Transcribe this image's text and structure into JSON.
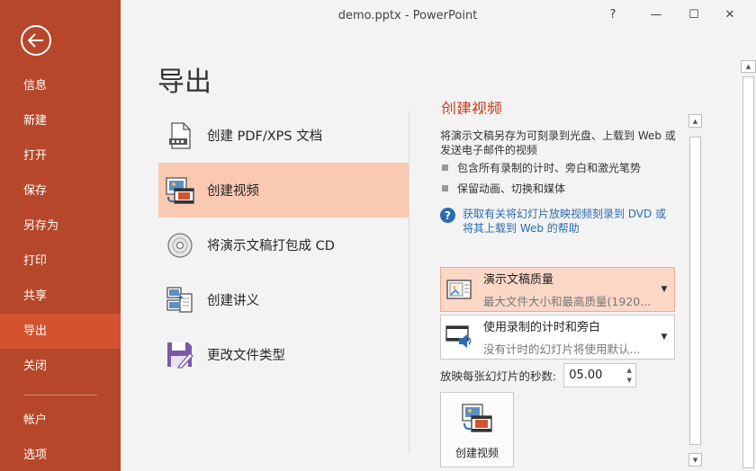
{
  "window": {
    "title": "demo.pptx - PowerPoint",
    "help_glyph": "?",
    "minimize_glyph": "—",
    "maximize_glyph": "☐",
    "close_glyph": "✕"
  },
  "colors": {
    "sidebar_bg": "#b7472a",
    "sidebar_active": "#d35230",
    "option_active_bg": "#fac9b2",
    "heading_accent": "#c43e1c",
    "link": "#2b6cb0"
  },
  "sidebar": {
    "back_icon": "back-arrow-icon",
    "items": [
      {
        "label": "信息"
      },
      {
        "label": "新建"
      },
      {
        "label": "打开"
      },
      {
        "label": "保存"
      },
      {
        "label": "另存为"
      },
      {
        "label": "打印"
      },
      {
        "label": "共享"
      },
      {
        "label": "导出",
        "active": true
      },
      {
        "label": "关闭"
      }
    ],
    "bottom_items": [
      {
        "label": "帐户"
      },
      {
        "label": "选项"
      }
    ]
  },
  "main": {
    "title": "导出",
    "options": [
      {
        "label": "创建 PDF/XPS 文档",
        "icon": "pdf-document-icon"
      },
      {
        "label": "创建视频",
        "icon": "video-icon",
        "active": true
      },
      {
        "label": "将演示文稿打包成 CD",
        "icon": "cd-icon"
      },
      {
        "label": "创建讲义",
        "icon": "handout-icon"
      },
      {
        "label": "更改文件类型",
        "icon": "save-disk-icon"
      }
    ]
  },
  "detail": {
    "heading": "创建视频",
    "description": "将演示文稿另存为可刻录到光盘、上载到 Web 或发送电子邮件的视频",
    "bullets": [
      "包含所有录制的计时、旁白和激光笔势",
      "保留动画、切换和媒体"
    ],
    "help_glyph": "?",
    "help_link": "获取有关将幻灯片放映视频刻录到 DVD 或将其上载到 Web 的帮助",
    "quality": {
      "title": "演示文稿质量",
      "subtitle": "最大文件大小和最高质量(1920..."
    },
    "timing": {
      "title": "使用录制的计时和旁白",
      "subtitle": "没有计时的幻灯片将使用默认..."
    },
    "seconds_label": "放映每张幻灯片的秒数:",
    "seconds_value": "05.00",
    "create_button": "创建视频"
  }
}
